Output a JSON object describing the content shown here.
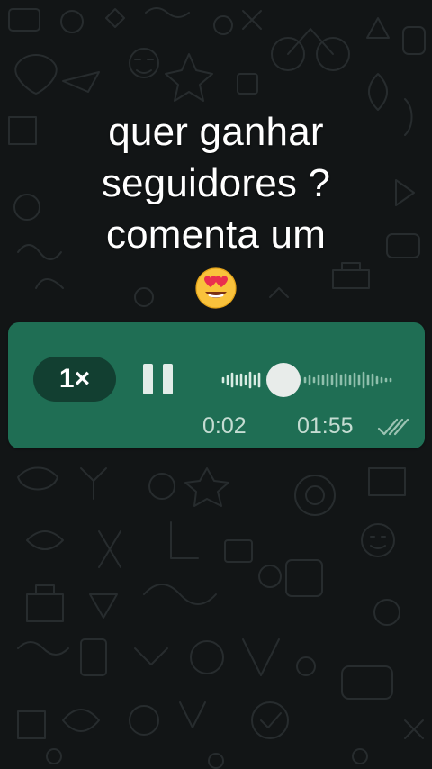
{
  "caption": {
    "lines": [
      "quer ganhar",
      "seguidores ?",
      "comenta um"
    ],
    "emoji": "heart-eyes-emoji"
  },
  "voice_message": {
    "speed_label": "1×",
    "current_time": "0:02",
    "duration": "01:55",
    "progress": 0.3,
    "status": "delivered",
    "colors": {
      "bubble": "#1f6e54",
      "speed_pill": "#123f31",
      "text": "#c5dcd2"
    }
  },
  "icons": {
    "pause": "pause-icon",
    "waveform": "waveform-icon",
    "delivered": "double-check-icon"
  }
}
